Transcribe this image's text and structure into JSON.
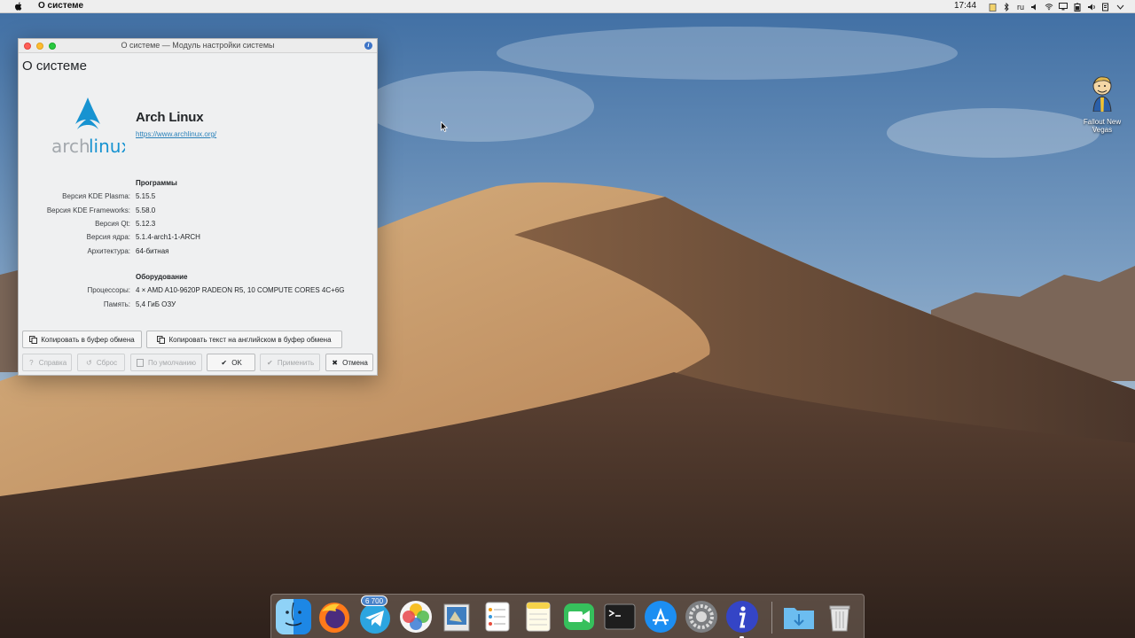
{
  "menubar": {
    "app_name": "О системе",
    "clock": "17:44",
    "keyboard_layout": "ru",
    "tray_icons": [
      "clipboard-icon",
      "bluetooth-icon",
      "keyboard-layout",
      "volume-icon",
      "wifi-icon",
      "display-icon",
      "battery-icon",
      "volume-icon",
      "notifications-icon",
      "chevron-down-icon",
      "search-icon"
    ]
  },
  "window": {
    "title": "О системе — Модуль настройки системы",
    "page_title": "О системе",
    "distro_name": "Arch Linux",
    "distro_url": "https://www.archlinux.org/",
    "logo_text_arch": "arch",
    "logo_text_linux": "linux",
    "software": {
      "heading": "Программы",
      "rows": [
        {
          "label": "Версия KDE Plasma:",
          "value": "5.15.5"
        },
        {
          "label": "Версия KDE Frameworks:",
          "value": "5.58.0"
        },
        {
          "label": "Версия Qt:",
          "value": "5.12.3"
        },
        {
          "label": "Версия ядра:",
          "value": "5.1.4-arch1-1-ARCH"
        },
        {
          "label": "Архитектура:",
          "value": "64-битная"
        }
      ]
    },
    "hardware": {
      "heading": "Оборудование",
      "rows": [
        {
          "label": "Процессоры:",
          "value": "4 × AMD A10-9620P RADEON R5, 10 COMPUTE CORES 4C+6G"
        },
        {
          "label": "Память:",
          "value": "5,4 ГиБ ОЗУ"
        }
      ]
    },
    "buttons": {
      "copy": "Копировать в буфер обмена",
      "copy_english": "Копировать текст на английском в буфер обмена",
      "help": "Справка",
      "reset": "Сброс",
      "defaults": "По умолчанию",
      "ok": "OK",
      "apply": "Применить",
      "cancel": "Отмена"
    }
  },
  "desktop": {
    "icon_label": "Fallout New Vegas"
  },
  "dock": {
    "items": [
      "finder",
      "firefox",
      "telegram",
      "photos",
      "preview",
      "reminders",
      "notes",
      "facetime",
      "terminal",
      "app-store",
      "system-preferences",
      "info-center",
      "downloads-folder",
      "trash"
    ],
    "telegram_badge": "6 700"
  },
  "colors": {
    "accent": "#2980b9",
    "arch_blue": "#1793d1",
    "window_bg": "#eff0f1",
    "menubar_bg": "#eeeeee"
  }
}
